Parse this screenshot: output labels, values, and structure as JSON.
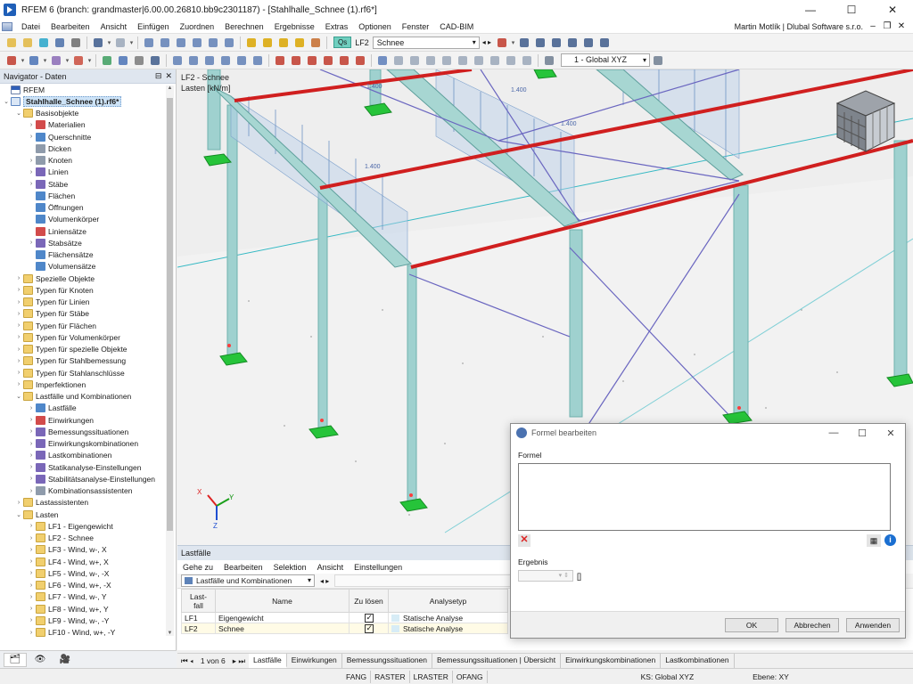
{
  "window": {
    "title": "RFEM 6 (branch: grandmaster|6.00.00.26810.bb9c2301187) - [Stahlhalle_Schnee (1).rf6*]",
    "minimize": "—",
    "maximize": "☐",
    "close": "✕"
  },
  "menu": {
    "items": [
      "Datei",
      "Bearbeiten",
      "Ansicht",
      "Einfügen",
      "Zuordnen",
      "Berechnen",
      "Ergebnisse",
      "Extras",
      "Optionen",
      "Fenster",
      "CAD-BIM"
    ],
    "user": "Martin Motlík | Dlubal Software s.r.o.",
    "mdi_buttons": [
      "–",
      "❐",
      "✕"
    ]
  },
  "toolbar": {
    "loadcase_badge": "Qs",
    "loadcase_code": "LF2",
    "loadcase_name": "Schnee",
    "coord_system": "1 - Global XYZ"
  },
  "navigator": {
    "title": "Navigator - Daten",
    "header_buttons": [
      "⊟",
      "✕"
    ],
    "tree": [
      {
        "label": "RFEM",
        "level": 0,
        "icon": "flag",
        "exp": ""
      },
      {
        "label": "Stahlhalle_Schnee (1).rf6*",
        "level": 0,
        "icon": "file",
        "exp": "⌄",
        "selected": true
      },
      {
        "label": "Basisobjekte",
        "level": 1,
        "icon": "folder",
        "exp": "⌄"
      },
      {
        "label": "Materialien",
        "level": 2,
        "icon": "red",
        "exp": "›"
      },
      {
        "label": "Querschnitte",
        "level": 2,
        "icon": "blue",
        "exp": "›"
      },
      {
        "label": "Dicken",
        "level": 2,
        "icon": "gray",
        "exp": ""
      },
      {
        "label": "Knoten",
        "level": 2,
        "icon": "gray",
        "exp": "›"
      },
      {
        "label": "Linien",
        "level": 2,
        "icon": "purple",
        "exp": "›"
      },
      {
        "label": "Stäbe",
        "level": 2,
        "icon": "purple",
        "exp": "›"
      },
      {
        "label": "Flächen",
        "level": 2,
        "icon": "blue",
        "exp": ""
      },
      {
        "label": "Öffnungen",
        "level": 2,
        "icon": "blue",
        "exp": ""
      },
      {
        "label": "Volumenkörper",
        "level": 2,
        "icon": "blue",
        "exp": ""
      },
      {
        "label": "Liniensätze",
        "level": 2,
        "icon": "red",
        "exp": ""
      },
      {
        "label": "Stabsätze",
        "level": 2,
        "icon": "purple",
        "exp": "›"
      },
      {
        "label": "Flächensätze",
        "level": 2,
        "icon": "blue",
        "exp": ""
      },
      {
        "label": "Volumensätze",
        "level": 2,
        "icon": "blue",
        "exp": ""
      },
      {
        "label": "Spezielle Objekte",
        "level": 1,
        "icon": "folder",
        "exp": "›"
      },
      {
        "label": "Typen für Knoten",
        "level": 1,
        "icon": "folder",
        "exp": "›"
      },
      {
        "label": "Typen für Linien",
        "level": 1,
        "icon": "folder",
        "exp": "›"
      },
      {
        "label": "Typen für Stäbe",
        "level": 1,
        "icon": "folder",
        "exp": "›"
      },
      {
        "label": "Typen für Flächen",
        "level": 1,
        "icon": "folder",
        "exp": "›"
      },
      {
        "label": "Typen für Volumenkörper",
        "level": 1,
        "icon": "folder",
        "exp": "›"
      },
      {
        "label": "Typen für spezielle Objekte",
        "level": 1,
        "icon": "folder",
        "exp": "›"
      },
      {
        "label": "Typen für Stahlbemessung",
        "level": 1,
        "icon": "folder",
        "exp": "›"
      },
      {
        "label": "Typen für Stahlanschlüsse",
        "level": 1,
        "icon": "folder",
        "exp": "›"
      },
      {
        "label": "Imperfektionen",
        "level": 1,
        "icon": "folder",
        "exp": "›"
      },
      {
        "label": "Lastfälle und Kombinationen",
        "level": 1,
        "icon": "folder",
        "exp": "⌄"
      },
      {
        "label": "Lastfälle",
        "level": 2,
        "icon": "blue",
        "exp": "›"
      },
      {
        "label": "Einwirkungen",
        "level": 2,
        "icon": "red",
        "exp": "›"
      },
      {
        "label": "Bemessungssituationen",
        "level": 2,
        "icon": "purple",
        "exp": "›"
      },
      {
        "label": "Einwirkungskombinationen",
        "level": 2,
        "icon": "purple",
        "exp": "›"
      },
      {
        "label": "Lastkombinationen",
        "level": 2,
        "icon": "purple",
        "exp": "›"
      },
      {
        "label": "Statikanalyse-Einstellungen",
        "level": 2,
        "icon": "purple",
        "exp": "›"
      },
      {
        "label": "Stabilitätsanalyse-Einstellungen",
        "level": 2,
        "icon": "purple",
        "exp": "›"
      },
      {
        "label": "Kombinationsassistenten",
        "level": 2,
        "icon": "gray",
        "exp": "›"
      },
      {
        "label": "Lastassistenten",
        "level": 1,
        "icon": "folder",
        "exp": "›"
      },
      {
        "label": "Lasten",
        "level": 1,
        "icon": "folder",
        "exp": "⌄"
      },
      {
        "label": "LF1 - Eigengewicht",
        "level": 2,
        "icon": "folder",
        "exp": "›"
      },
      {
        "label": "LF2 - Schnee",
        "level": 2,
        "icon": "folder",
        "exp": "›"
      },
      {
        "label": "LF3 - Wind, w-, X",
        "level": 2,
        "icon": "folder",
        "exp": "›"
      },
      {
        "label": "LF4 - Wind, w+, X",
        "level": 2,
        "icon": "folder",
        "exp": "›"
      },
      {
        "label": "LF5 - Wind, w-, -X",
        "level": 2,
        "icon": "folder",
        "exp": "›"
      },
      {
        "label": "LF6 - Wind, w+, -X",
        "level": 2,
        "icon": "folder",
        "exp": "›"
      },
      {
        "label": "LF7 - Wind, w-, Y",
        "level": 2,
        "icon": "folder",
        "exp": "›"
      },
      {
        "label": "LF8 - Wind, w+, Y",
        "level": 2,
        "icon": "folder",
        "exp": "›"
      },
      {
        "label": "LF9 - Wind, w-, -Y",
        "level": 2,
        "icon": "folder",
        "exp": "›"
      },
      {
        "label": "LF10 - Wind, w+, -Y",
        "level": 2,
        "icon": "folder",
        "exp": "›"
      }
    ]
  },
  "viewport": {
    "line1": "LF2 - Schnee",
    "line2": "Lasten [kN/m]",
    "load_labels": [
      "1.400",
      "1.400",
      "1.400",
      "1.400"
    ],
    "axis_x": "X",
    "axis_y": "Y",
    "axis_z": "Z"
  },
  "dialog": {
    "title": "Formel bearbeiten",
    "formula_label": "Formel",
    "result_label": "Ergebnis",
    "result_bracket": "[]",
    "ok": "OK",
    "cancel": "Abbrechen",
    "apply": "Anwenden"
  },
  "panel": {
    "title": "Lastfälle",
    "menu": [
      "Gehe zu",
      "Bearbeiten",
      "Selektion",
      "Ansicht",
      "Einstellungen"
    ],
    "combo": "Lastfälle und Kombinationen",
    "columns": [
      "Last-\nfall",
      "Name",
      "Zu lösen",
      "Analysetyp"
    ],
    "rows": [
      {
        "id": "LF1",
        "name": "Eigengewicht",
        "solve": true,
        "type": "Statische Analyse"
      },
      {
        "id": "LF2",
        "name": "Schnee",
        "solve": true,
        "type": "Statische Analyse"
      }
    ]
  },
  "tabs": {
    "pager": "1 von 6",
    "items": [
      "Lastfälle",
      "Einwirkungen",
      "Bemessungssituationen",
      "Bemessungssituationen | Übersicht",
      "Einwirkungskombinationen",
      "Lastkombinationen"
    ],
    "active": 0
  },
  "status": {
    "toggles": [
      "FANG",
      "RASTER",
      "LRASTER",
      "OFANG"
    ],
    "coord": "KS: Global XYZ",
    "plane": "Ebene: XY"
  }
}
